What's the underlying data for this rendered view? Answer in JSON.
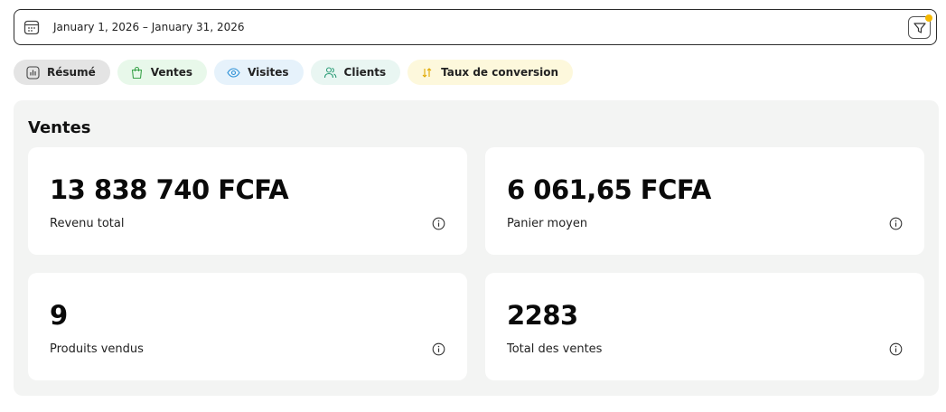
{
  "date_range": {
    "text": "January 1, 2026 – January 31, 2026"
  },
  "tabs": [
    {
      "label": "Résumé",
      "icon": "bar-chart-icon"
    },
    {
      "label": "Ventes",
      "icon": "shopping-bag-icon"
    },
    {
      "label": "Visites",
      "icon": "eye-icon"
    },
    {
      "label": "Clients",
      "icon": "users-icon"
    },
    {
      "label": "Taux de conversion",
      "icon": "sort-arrows-icon"
    }
  ],
  "section": {
    "title": "Ventes",
    "cards": [
      {
        "value": "13 838 740 FCFA",
        "label": "Revenu total"
      },
      {
        "value": "6 061,65 FCFA",
        "label": "Panier moyen"
      },
      {
        "value": "9",
        "label": "Produits vendus"
      },
      {
        "value": "2283",
        "label": "Total des ventes"
      }
    ]
  },
  "colors": {
    "accent_dot": "#f5b800",
    "ventes_icon": "#3aa34a",
    "visites_icon": "#2a8fd6",
    "clients_icon": "#2e9d78",
    "taux_icon": "#e0a800"
  }
}
